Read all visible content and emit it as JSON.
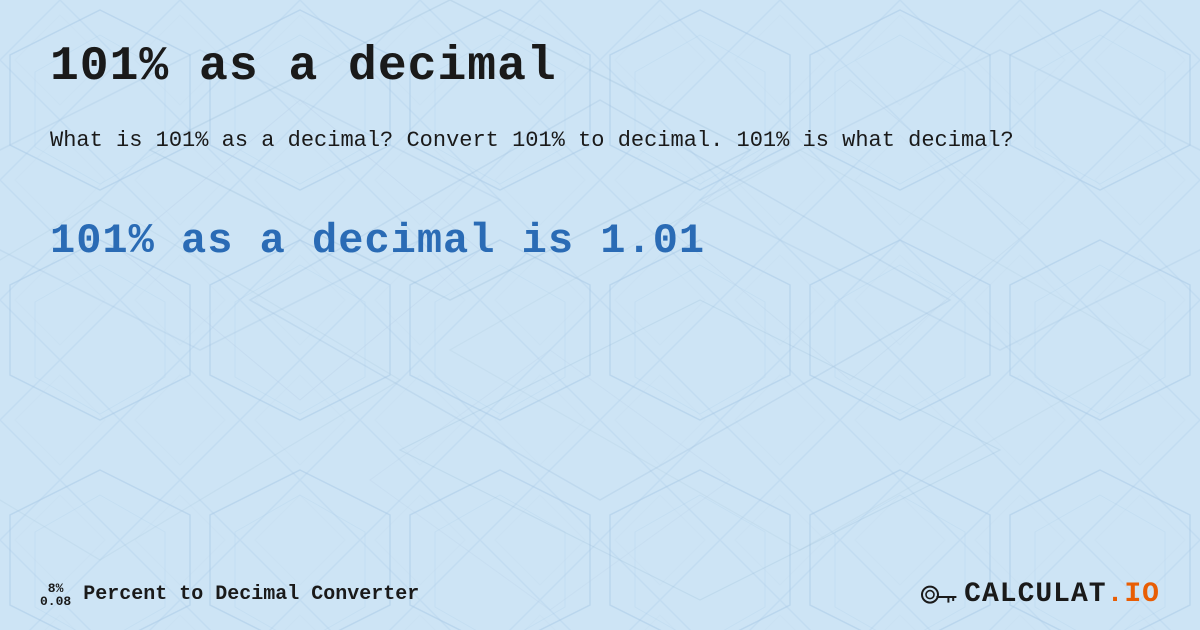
{
  "page": {
    "title": "101% as a decimal",
    "description": "What is 101% as a decimal? Convert 101% to decimal. 101% is what decimal?",
    "result": "101% as a decimal is 1.01"
  },
  "footer": {
    "percent_top": "8%",
    "percent_bottom": "0.08",
    "brand_text": "Percent to Decimal Converter",
    "logo_text": "CALCULAT",
    "logo_suffix": ".IO"
  },
  "background": {
    "color": "#cde4f5",
    "pattern_color": "#b8d4ec"
  }
}
